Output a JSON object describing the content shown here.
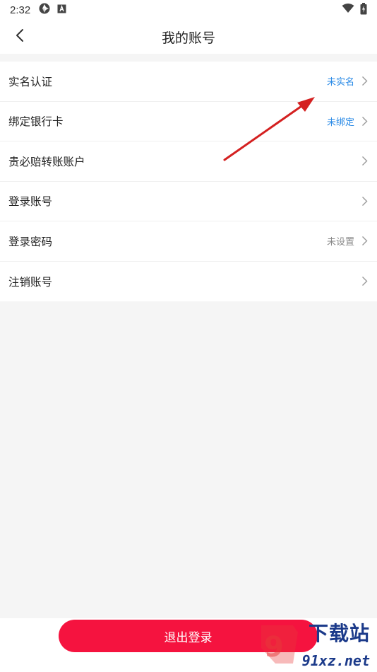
{
  "status_bar": {
    "time": "2:32",
    "icons": [
      "aperture-icon",
      "font-a-icon",
      "wifi-icon",
      "battery-icon"
    ]
  },
  "header": {
    "title": "我的账号",
    "back_icon": "back-chevron-icon"
  },
  "menu": {
    "items": [
      {
        "label": "实名认证",
        "status": "未实名",
        "status_color": "#2a8ae6"
      },
      {
        "label": "绑定银行卡",
        "status": "未绑定",
        "status_color": "#2a8ae6"
      },
      {
        "label": "贵必赔转账账户",
        "status": "",
        "status_color": ""
      },
      {
        "label": "登录账号",
        "status": "",
        "status_color": ""
      },
      {
        "label": "登录密码",
        "status": "未设置",
        "status_color": "#888888"
      },
      {
        "label": "注销账号",
        "status": "",
        "status_color": ""
      }
    ]
  },
  "footer": {
    "logout_label": "退出登录"
  },
  "watermark": {
    "top": "下载站",
    "bottom": "91xz.net"
  },
  "colors": {
    "accent": "#f5133f",
    "link_blue": "#2a8ae6",
    "annotation_red": "#d42020"
  }
}
